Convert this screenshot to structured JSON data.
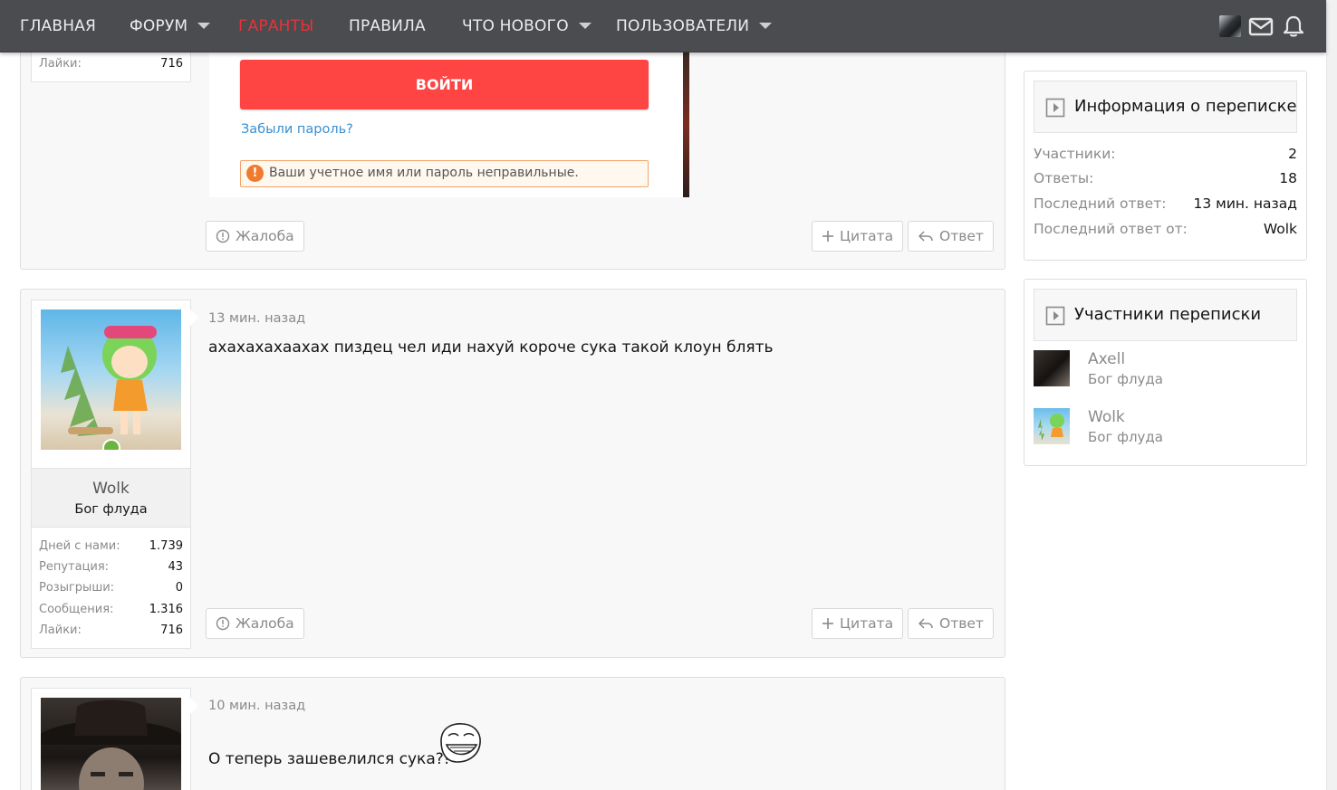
{
  "nav": {
    "items": [
      {
        "label": "ГЛАВНАЯ",
        "dropdown": false,
        "highlight": false
      },
      {
        "label": "ФОРУМ",
        "dropdown": true,
        "highlight": false
      },
      {
        "label": "ГАРАНТЫ",
        "dropdown": false,
        "highlight": true
      },
      {
        "label": "ПРАВИЛА",
        "dropdown": false,
        "highlight": false
      },
      {
        "label": "ЧТО НОВОГО",
        "dropdown": true,
        "highlight": false
      },
      {
        "label": "ПОЛЬЗОВАТЕЛИ",
        "dropdown": true,
        "highlight": false
      }
    ]
  },
  "colors": {
    "nav_bg": "#4a4c4f",
    "login_button": "#ff4444",
    "highlight": "#e8323a",
    "link": "#3a8fd0",
    "error_border": "#f5a36a"
  },
  "post1": {
    "likes_label": "Лайки:",
    "likes_value": "716",
    "screenshot": {
      "login_button": "ВОЙТИ",
      "forgot_link": "Забыли пароль?",
      "error_text": "Ваши учетное имя или пароль неправильные."
    },
    "report_label": "Жалоба",
    "quote_label": "Цитата",
    "reply_label": "Ответ"
  },
  "post2": {
    "username": "Wolk",
    "user_title": "Бог флуда",
    "time": "13 мин. назад",
    "message": "ахахахахаахах пиздец чел иди нахуй короче сука такой клоун блять",
    "stats": [
      {
        "label": "Дней с нами:",
        "value": "1.739"
      },
      {
        "label": "Репутация:",
        "value": "43"
      },
      {
        "label": "Розыгрыши:",
        "value": "0"
      },
      {
        "label": "Сообщения:",
        "value": "1.316"
      },
      {
        "label": "Лайки:",
        "value": "716"
      }
    ],
    "report_label": "Жалоба",
    "quote_label": "Цитата",
    "reply_label": "Ответ"
  },
  "post3": {
    "time": "10 мин. назад",
    "message": "О теперь зашевелился сука?!"
  },
  "sidebar": {
    "info": {
      "title": "Информация о переписке",
      "rows": [
        {
          "label": "Участники:",
          "value": "2"
        },
        {
          "label": "Ответы:",
          "value": "18"
        },
        {
          "label": "Последний ответ:",
          "value": "13 мин. назад"
        },
        {
          "label": "Последний ответ от:",
          "value": "Wolk"
        }
      ]
    },
    "participants": {
      "title": "Участники переписки",
      "members": [
        {
          "name": "Axell",
          "title": "Бог флуда"
        },
        {
          "name": "Wolk",
          "title": "Бог флуда"
        }
      ]
    }
  }
}
